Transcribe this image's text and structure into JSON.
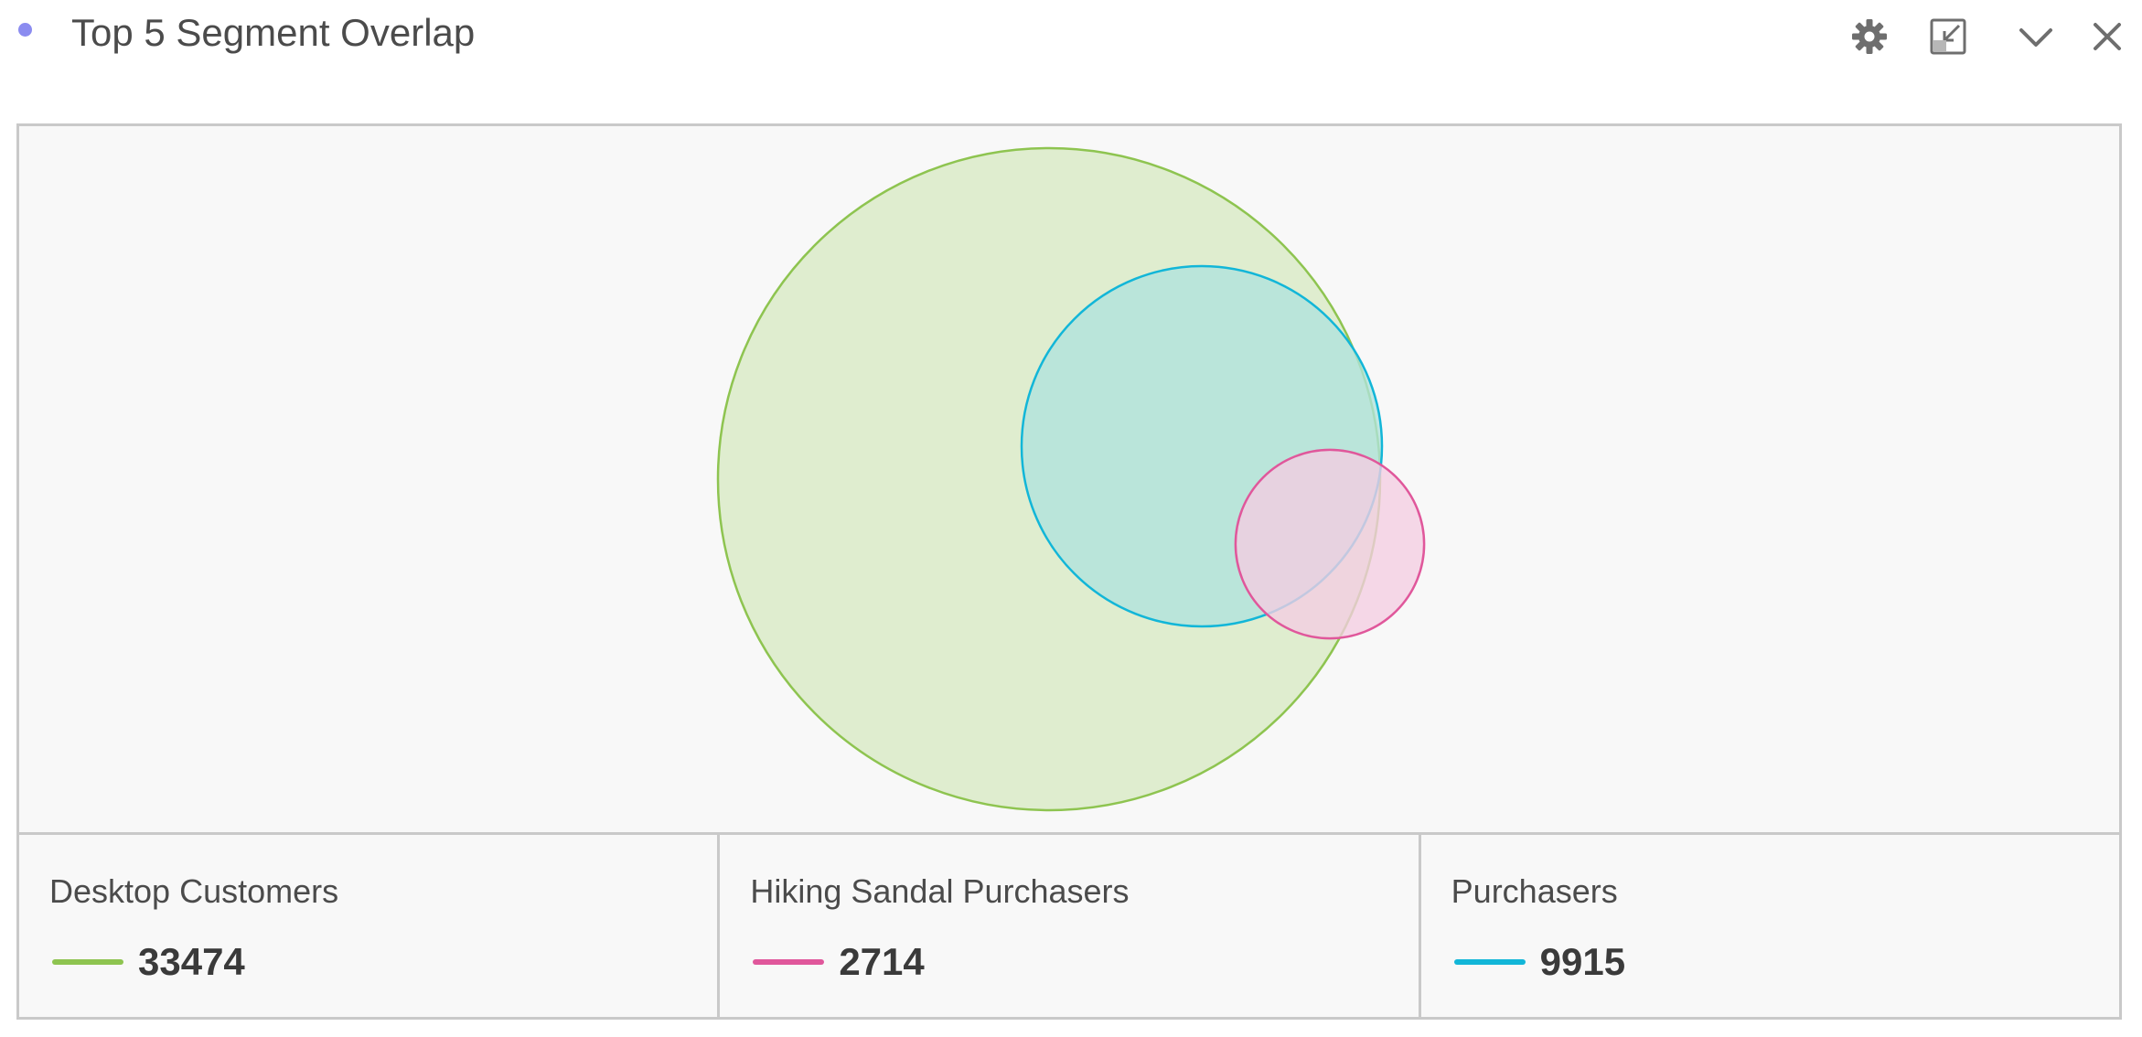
{
  "panel": {
    "title": "Top 5 Segment Overlap",
    "status_color": "#8b8cf0",
    "actions": [
      {
        "name": "settings-button",
        "icon": "gear-icon"
      },
      {
        "name": "expand-button",
        "icon": "expand-icon"
      },
      {
        "name": "collapse-button",
        "icon": "chevron-down-icon"
      },
      {
        "name": "close-button",
        "icon": "close-icon"
      }
    ]
  },
  "colors": {
    "icon": "#6e6e6e",
    "frame_border": "#c9c9c9",
    "frame_background": "#f8f8f8"
  },
  "chart_data": {
    "type": "venn",
    "sets": [
      {
        "name": "Desktop Customers",
        "value": 33474,
        "color": "#8ec450",
        "fill": "#dfedcf"
      },
      {
        "name": "Hiking Sandal Purchasers",
        "value": 2714,
        "color": "#e0579b",
        "fill": "#f4cde1"
      },
      {
        "name": "Purchasers",
        "value": 9915,
        "color": "#12b6d8",
        "fill": "#b0e3dc"
      }
    ]
  }
}
